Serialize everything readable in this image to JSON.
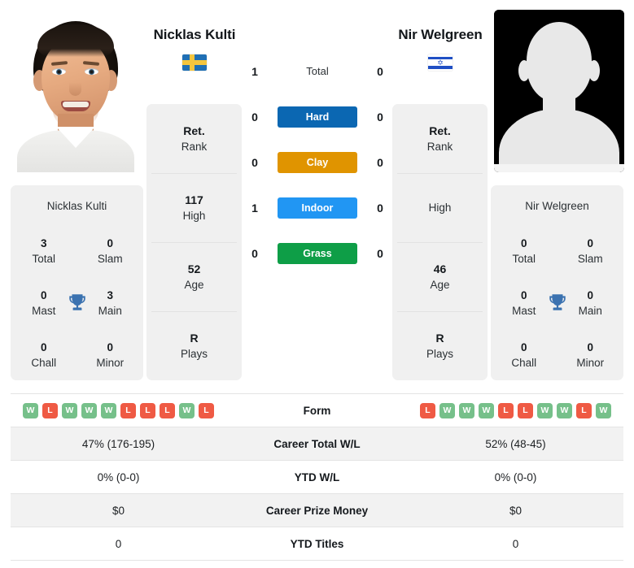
{
  "players": {
    "left": {
      "name": "Nicklas Kulti",
      "flag": "sweden-flag",
      "photo": "player-portrait-photo",
      "rank_card": [
        {
          "value": "Ret.",
          "label": "Rank"
        },
        {
          "value": "117",
          "label": "High"
        },
        {
          "value": "52",
          "label": "Age"
        },
        {
          "value": "R",
          "label": "Plays"
        }
      ],
      "titles": {
        "heading": "Nicklas Kulti",
        "cells": [
          {
            "value": "3",
            "label": "Total"
          },
          {
            "value": "0",
            "label": "Slam"
          },
          {
            "value": "0",
            "label": "Mast"
          },
          {
            "value": "3",
            "label": "Main"
          },
          {
            "value": "0",
            "label": "Chall"
          },
          {
            "value": "0",
            "label": "Minor"
          }
        ],
        "icon": "trophy-icon"
      },
      "form": [
        "W",
        "L",
        "W",
        "W",
        "W",
        "L",
        "L",
        "L",
        "W",
        "L"
      ],
      "career_total_wl": "47% (176-195)",
      "ytd_wl": "0% (0-0)",
      "career_prize_money": "$0",
      "ytd_titles": "0"
    },
    "right": {
      "name": "Nir Welgreen",
      "flag": "israel-flag",
      "photo": "silhouette-placeholder-avatar",
      "rank_card": [
        {
          "value": "Ret.",
          "label": "Rank"
        },
        {
          "value": "",
          "label": "High"
        },
        {
          "value": "46",
          "label": "Age"
        },
        {
          "value": "R",
          "label": "Plays"
        }
      ],
      "titles": {
        "heading": "Nir Welgreen",
        "cells": [
          {
            "value": "0",
            "label": "Total"
          },
          {
            "value": "0",
            "label": "Slam"
          },
          {
            "value": "0",
            "label": "Mast"
          },
          {
            "value": "0",
            "label": "Main"
          },
          {
            "value": "0",
            "label": "Chall"
          },
          {
            "value": "0",
            "label": "Minor"
          }
        ],
        "icon": "trophy-icon"
      },
      "form": [
        "L",
        "W",
        "W",
        "W",
        "L",
        "L",
        "W",
        "W",
        "L",
        "W"
      ],
      "career_total_wl": "52% (48-45)",
      "ytd_wl": "0% (0-0)",
      "career_prize_money": "$0",
      "ytd_titles": "0"
    }
  },
  "head_to_head": {
    "rows": [
      {
        "surface": "Total",
        "left": "1",
        "right": "0",
        "color": ""
      },
      {
        "surface": "Hard",
        "left": "0",
        "right": "0",
        "color": "#0b67b2"
      },
      {
        "surface": "Clay",
        "left": "0",
        "right": "0",
        "color": "#e09400"
      },
      {
        "surface": "Indoor",
        "left": "1",
        "right": "0",
        "color": "#2196f3"
      },
      {
        "surface": "Grass",
        "left": "0",
        "right": "0",
        "color": "#0e9e47"
      }
    ]
  },
  "stats_table": {
    "rows": [
      {
        "label": "Form",
        "type": "form"
      },
      {
        "label": "Career Total W/L",
        "type": "text",
        "key": "career_total_wl"
      },
      {
        "label": "YTD W/L",
        "type": "text",
        "key": "ytd_wl"
      },
      {
        "label": "Career Prize Money",
        "type": "text",
        "key": "career_prize_money"
      },
      {
        "label": "YTD Titles",
        "type": "text",
        "key": "ytd_titles"
      }
    ]
  },
  "colors": {
    "card_bg": "#f0f0f0",
    "row_shade": "#f2f2f2",
    "win": "#76c08a",
    "loss": "#ef5a44",
    "trophy": "#3b72b0"
  }
}
